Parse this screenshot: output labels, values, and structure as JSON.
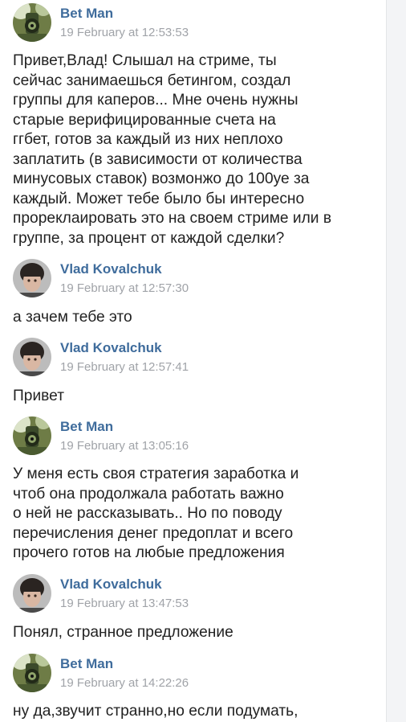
{
  "messages": [
    {
      "author": "Bet Man",
      "time": "19 February at 12:53:53",
      "avatar": "betman-avatar",
      "text": "Привет,Влад! Слышал на стриме, ты\nсейчас занимаешься бетингом, создал\nгруппы для каперов... Мне очень нужны\nстарые верифицированные счета на\nггбет, готов за каждый из них неплохо\nзаплатить (в зависимости от количества\nминусовых ставок) возмонжо до 100уе за\nкаждый. Может тебе было бы интересно\nпрореклаировать это на своем стриме или в\nгруппе, за процент от каждой сделки?"
    },
    {
      "author": "Vlad Kovalchuk",
      "time": "19 February at 12:57:30",
      "avatar": "vlad-avatar",
      "text": "а зачем тебе это"
    },
    {
      "author": "Vlad Kovalchuk",
      "time": "19 February at 12:57:41",
      "avatar": "vlad-avatar",
      "text": "Привет"
    },
    {
      "author": "Bet Man",
      "time": "19 February at 13:05:16",
      "avatar": "betman-avatar",
      "text": "У меня есть своя стратегия заработка и\nчтоб она продолжала работать важно\nо ней не рассказывать.. Но по поводу\nперечисления денег предоплат и всего\nпрочего готов на любые предложения"
    },
    {
      "author": "Vlad Kovalchuk",
      "time": "19 February at 13:47:53",
      "avatar": "vlad-avatar",
      "text": "Понял, странное предложение"
    },
    {
      "author": "Bet Man",
      "time": "19 February at 14:22:26",
      "avatar": "betman-avatar",
      "text": "ну да,звучит странно,но если подумать,"
    }
  ],
  "colors": {
    "author_link": "#3f6c9c",
    "timestamp": "#a0a3a8",
    "message_text": "#222222",
    "background": "#ffffff"
  }
}
